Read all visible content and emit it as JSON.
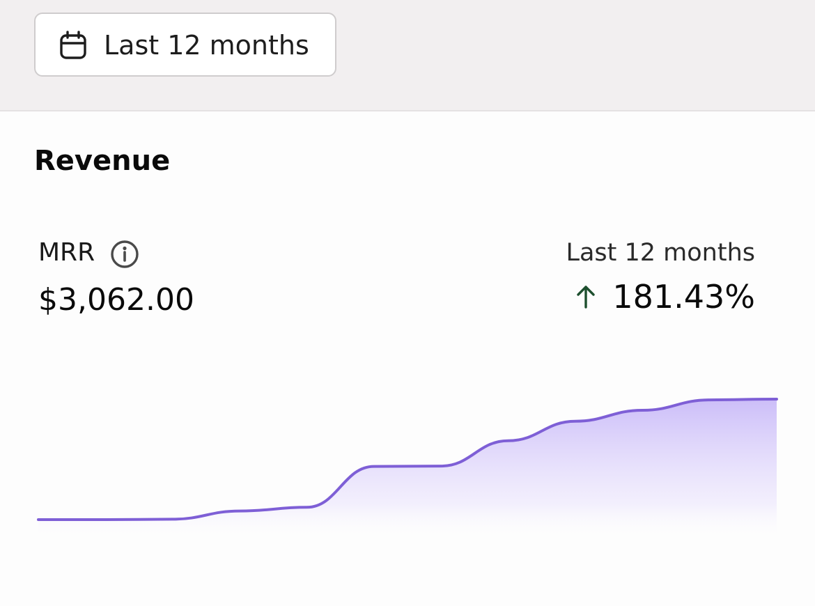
{
  "range_selector": {
    "label": "Last 12 months",
    "icon": "calendar-icon"
  },
  "card": {
    "title": "Revenue"
  },
  "metric": {
    "label": "MRR",
    "info_icon": "info-icon",
    "value": "$3,062.00"
  },
  "comparison": {
    "period": "Last 12 months",
    "direction_icon": "arrow-up-icon",
    "change": "181.43%"
  },
  "colors": {
    "line": "#7e5fd6",
    "area_top": "#c9baf8",
    "up_arrow": "#1d4f2e"
  },
  "chart_data": {
    "type": "area",
    "title": "",
    "xlabel": "",
    "ylabel": "",
    "grid": false,
    "x": [
      1,
      2,
      3,
      4,
      5,
      6,
      7,
      8,
      9,
      10,
      11,
      12
    ],
    "values": [
      1088,
      1088,
      1095,
      1230,
      1290,
      1960,
      1965,
      2380,
      2700,
      2880,
      3050,
      3062
    ],
    "ylim": [
      0,
      3062
    ]
  }
}
